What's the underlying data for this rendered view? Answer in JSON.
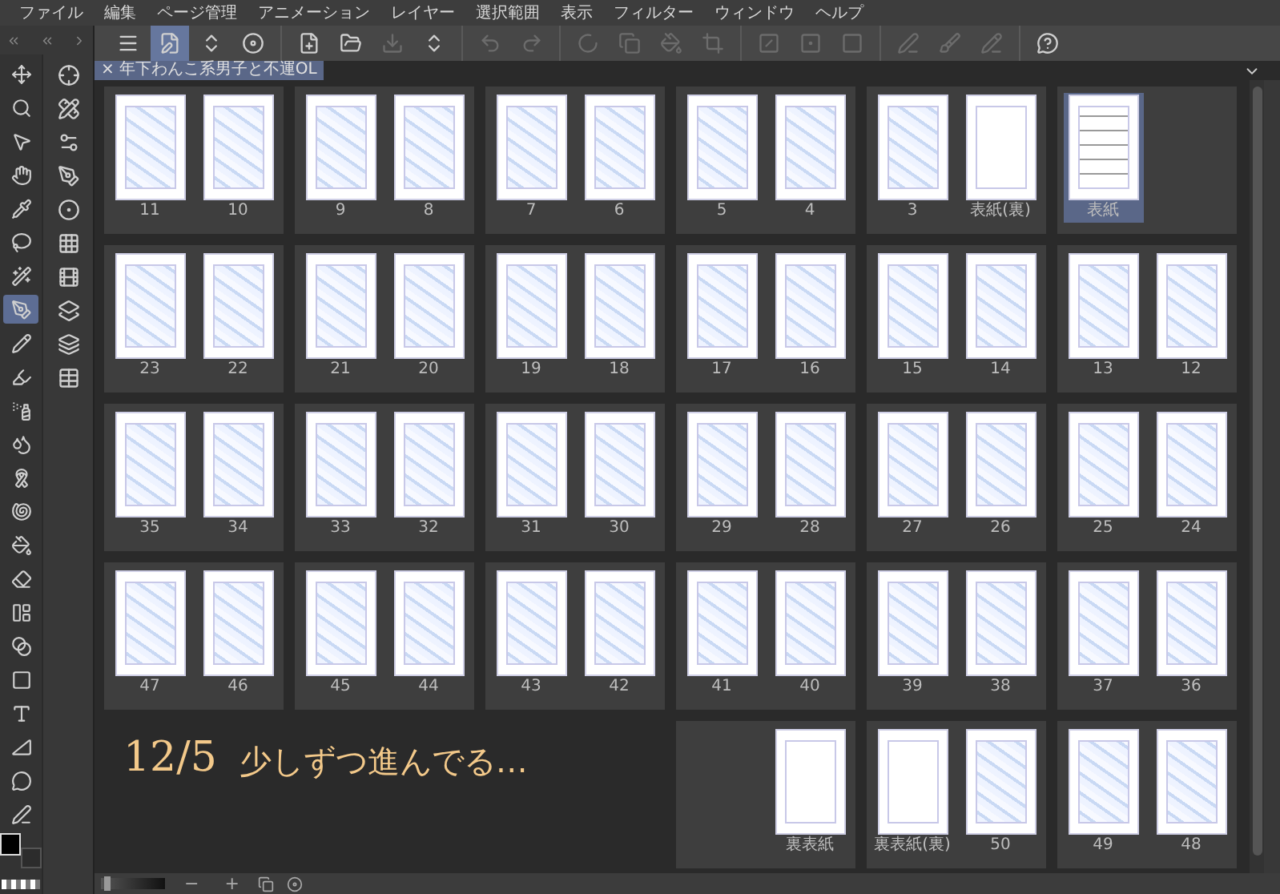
{
  "menu_bar": {
    "items": [
      "ファイル",
      "編集",
      "ページ管理",
      "アニメーション",
      "レイヤー",
      "選択範囲",
      "表示",
      "フィルター",
      "ウィンドウ",
      "ヘルプ"
    ]
  },
  "toolbar_groups": [
    [
      {
        "selected": false,
        "disabled": false
      },
      {
        "selected": true,
        "disabled": false
      },
      {
        "selected": false,
        "disabled": false
      },
      {
        "selected": false,
        "disabled": false
      }
    ],
    [
      {
        "selected": false,
        "disabled": false
      },
      {
        "selected": false,
        "disabled": false
      },
      {
        "selected": false,
        "disabled": true
      },
      {
        "selected": false,
        "disabled": false
      }
    ],
    [
      {
        "selected": false,
        "disabled": true
      },
      {
        "selected": false,
        "disabled": true
      }
    ],
    [
      {
        "selected": false,
        "disabled": true
      },
      {
        "selected": false,
        "disabled": true
      },
      {
        "selected": false,
        "disabled": true
      },
      {
        "selected": false,
        "disabled": true
      }
    ],
    [
      {
        "selected": false,
        "disabled": true
      },
      {
        "selected": false,
        "disabled": true
      },
      {
        "selected": false,
        "disabled": true
      }
    ],
    [
      {
        "selected": false,
        "disabled": true
      },
      {
        "selected": false,
        "disabled": true
      },
      {
        "selected": false,
        "disabled": true
      }
    ],
    [
      {
        "selected": false,
        "disabled": false
      }
    ]
  ],
  "tools": [
    {
      "selected": false
    },
    {
      "selected": false
    },
    {
      "selected": false
    },
    {
      "selected": false
    },
    {
      "selected": false
    },
    {
      "selected": false
    },
    {
      "selected": false
    },
    {
      "selected": true
    },
    {
      "selected": false
    },
    {
      "selected": false
    },
    {
      "selected": false
    },
    {
      "selected": false
    },
    {
      "selected": false
    },
    {
      "selected": false
    },
    {
      "selected": false
    },
    {
      "selected": false
    },
    {
      "selected": false
    },
    {
      "selected": false
    },
    {
      "selected": false
    },
    {
      "selected": false
    },
    {
      "selected": false
    },
    {
      "selected": false
    },
    {
      "selected": false
    }
  ],
  "document_tab": {
    "close": "×",
    "title": "年下わんこ系男子と不運OL"
  },
  "spread_rows": [
    [
      {
        "pages": [
          {
            "kind": "sketch",
            "label": "11",
            "selected": false
          },
          {
            "kind": "sketch",
            "label": "10",
            "selected": false
          }
        ]
      },
      {
        "pages": [
          {
            "kind": "sketch",
            "label": "9",
            "selected": false
          },
          {
            "kind": "sketch",
            "label": "8",
            "selected": false
          }
        ]
      },
      {
        "pages": [
          {
            "kind": "sketch",
            "label": "7",
            "selected": false
          },
          {
            "kind": "sketch",
            "label": "6",
            "selected": false
          }
        ]
      },
      {
        "pages": [
          {
            "kind": "sketch",
            "label": "5",
            "selected": false
          },
          {
            "kind": "sketch",
            "label": "4",
            "selected": false
          }
        ]
      },
      {
        "pages": [
          {
            "kind": "sketch",
            "label": "3",
            "selected": false
          },
          {
            "kind": "blank",
            "label": "表紙(裏)",
            "selected": false
          }
        ]
      },
      {
        "pages": [
          {
            "kind": "cover",
            "label": "表紙",
            "selected": true
          },
          {
            "kind": "empty"
          }
        ]
      }
    ],
    [
      {
        "pages": [
          {
            "kind": "sketch",
            "label": "23",
            "selected": false
          },
          {
            "kind": "sketch",
            "label": "22",
            "selected": false
          }
        ]
      },
      {
        "pages": [
          {
            "kind": "sketch",
            "label": "21",
            "selected": false
          },
          {
            "kind": "sketch",
            "label": "20",
            "selected": false
          }
        ]
      },
      {
        "pages": [
          {
            "kind": "sketch",
            "label": "19",
            "selected": false
          },
          {
            "kind": "sketch",
            "label": "18",
            "selected": false
          }
        ]
      },
      {
        "pages": [
          {
            "kind": "sketch",
            "label": "17",
            "selected": false
          },
          {
            "kind": "sketch",
            "label": "16",
            "selected": false
          }
        ]
      },
      {
        "pages": [
          {
            "kind": "sketch",
            "label": "15",
            "selected": false
          },
          {
            "kind": "sketch",
            "label": "14",
            "selected": false
          }
        ]
      },
      {
        "pages": [
          {
            "kind": "sketch",
            "label": "13",
            "selected": false
          },
          {
            "kind": "sketch",
            "label": "12",
            "selected": false
          }
        ]
      }
    ],
    [
      {
        "pages": [
          {
            "kind": "sketch",
            "label": "35",
            "selected": false
          },
          {
            "kind": "sketch",
            "label": "34",
            "selected": false
          }
        ]
      },
      {
        "pages": [
          {
            "kind": "sketch",
            "label": "33",
            "selected": false
          },
          {
            "kind": "sketch",
            "label": "32",
            "selected": false
          }
        ]
      },
      {
        "pages": [
          {
            "kind": "sketch",
            "label": "31",
            "selected": false
          },
          {
            "kind": "sketch",
            "label": "30",
            "selected": false
          }
        ]
      },
      {
        "pages": [
          {
            "kind": "sketch",
            "label": "29",
            "selected": false
          },
          {
            "kind": "sketch",
            "label": "28",
            "selected": false
          }
        ]
      },
      {
        "pages": [
          {
            "kind": "sketch",
            "label": "27",
            "selected": false
          },
          {
            "kind": "sketch",
            "label": "26",
            "selected": false
          }
        ]
      },
      {
        "pages": [
          {
            "kind": "sketch",
            "label": "25",
            "selected": false
          },
          {
            "kind": "sketch",
            "label": "24",
            "selected": false
          }
        ]
      }
    ],
    [
      {
        "pages": [
          {
            "kind": "sketch",
            "label": "47",
            "selected": false
          },
          {
            "kind": "sketch",
            "label": "46",
            "selected": false
          }
        ]
      },
      {
        "pages": [
          {
            "kind": "sketch",
            "label": "45",
            "selected": false
          },
          {
            "kind": "sketch",
            "label": "44",
            "selected": false
          }
        ]
      },
      {
        "pages": [
          {
            "kind": "sketch",
            "label": "43",
            "selected": false
          },
          {
            "kind": "sketch",
            "label": "42",
            "selected": false
          }
        ]
      },
      {
        "pages": [
          {
            "kind": "sketch",
            "label": "41",
            "selected": false
          },
          {
            "kind": "sketch",
            "label": "40",
            "selected": false
          }
        ]
      },
      {
        "pages": [
          {
            "kind": "sketch",
            "label": "39",
            "selected": false
          },
          {
            "kind": "sketch",
            "label": "38",
            "selected": false
          }
        ]
      },
      {
        "pages": [
          {
            "kind": "sketch",
            "label": "37",
            "selected": false
          },
          {
            "kind": "sketch",
            "label": "36",
            "selected": false
          }
        ]
      }
    ],
    [
      {
        "pages": [
          {
            "kind": "empty"
          },
          {
            "kind": "blank",
            "label": "裏表紙",
            "selected": false
          }
        ]
      },
      {
        "pages": [
          {
            "kind": "blank",
            "label": "裏表紙(裏)",
            "selected": false
          },
          {
            "kind": "sketch",
            "label": "50",
            "selected": false
          }
        ]
      },
      {
        "pages": [
          {
            "kind": "sketch",
            "label": "49",
            "selected": false
          },
          {
            "kind": "sketch",
            "label": "48",
            "selected": false
          }
        ]
      }
    ]
  ],
  "note": {
    "date": "12/5",
    "message": "少しずつ進んでる…"
  },
  "status_bar": {
    "zoom_slider": {
      "level": 0.05
    },
    "zoom_out": "−",
    "zoom_in": "+"
  }
}
